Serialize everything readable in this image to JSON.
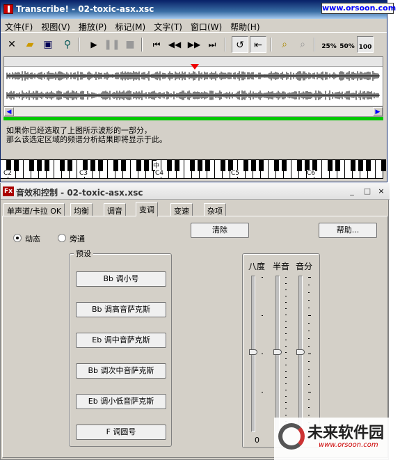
{
  "top_window": {
    "title": "Transcribe! - 02-toxic-asx.xsc",
    "watermark_url": "www.orsoon.com",
    "menu": [
      "文件(F)",
      "视图(V)",
      "播放(P)",
      "标记(M)",
      "文字(T)",
      "窗口(W)",
      "帮助(H)"
    ],
    "toolbar": {
      "icons": [
        "close-icon",
        "open-folder-icon",
        "save-icon",
        "tune-icon",
        "play-icon",
        "pause-icon",
        "stop-icon",
        "skip-start-icon",
        "rewind-icon",
        "fast-forward-icon",
        "skip-end-icon",
        "loop-icon",
        "arrow-left-bar-icon",
        "zoom-page-icon",
        "zoom-icon"
      ],
      "speed_labels": [
        "25%",
        "50%",
        "100"
      ]
    },
    "info_text_line1": "如果你已经选取了上图所示波形的一部分，",
    "info_text_line2": "那么该选定区域的频谱分析结果即将显示于此。",
    "piano_labels": [
      "C2",
      "C3",
      "C4",
      "C5",
      "C6"
    ],
    "piano_center_label": "中"
  },
  "fx_window": {
    "title": "音效和控制 - 02-toxic-asx.xsc",
    "window_buttons": [
      "_",
      "□",
      "×"
    ],
    "tabs": [
      "单声道/卡拉 OK",
      "均衡",
      "调音",
      "变调",
      "变速",
      "杂项"
    ],
    "selected_tab": "变调",
    "radio_dynamic": "动态",
    "radio_bypass": "旁通",
    "clear_button": "清除",
    "help_button": "帮助...",
    "presets_label": "预设",
    "presets": [
      "Bb 调小号",
      "Bb 调高音萨克斯",
      "Eb 调中音萨克斯",
      "Bb 调次中音萨克斯",
      "Eb 调小低音萨克斯",
      "F 调圆号"
    ],
    "slider_labels": [
      "八度",
      "半音",
      "音分"
    ],
    "slider_bottom_value": "0"
  },
  "logo": {
    "name": "未来软件园",
    "url": "www.orsoon.com"
  }
}
